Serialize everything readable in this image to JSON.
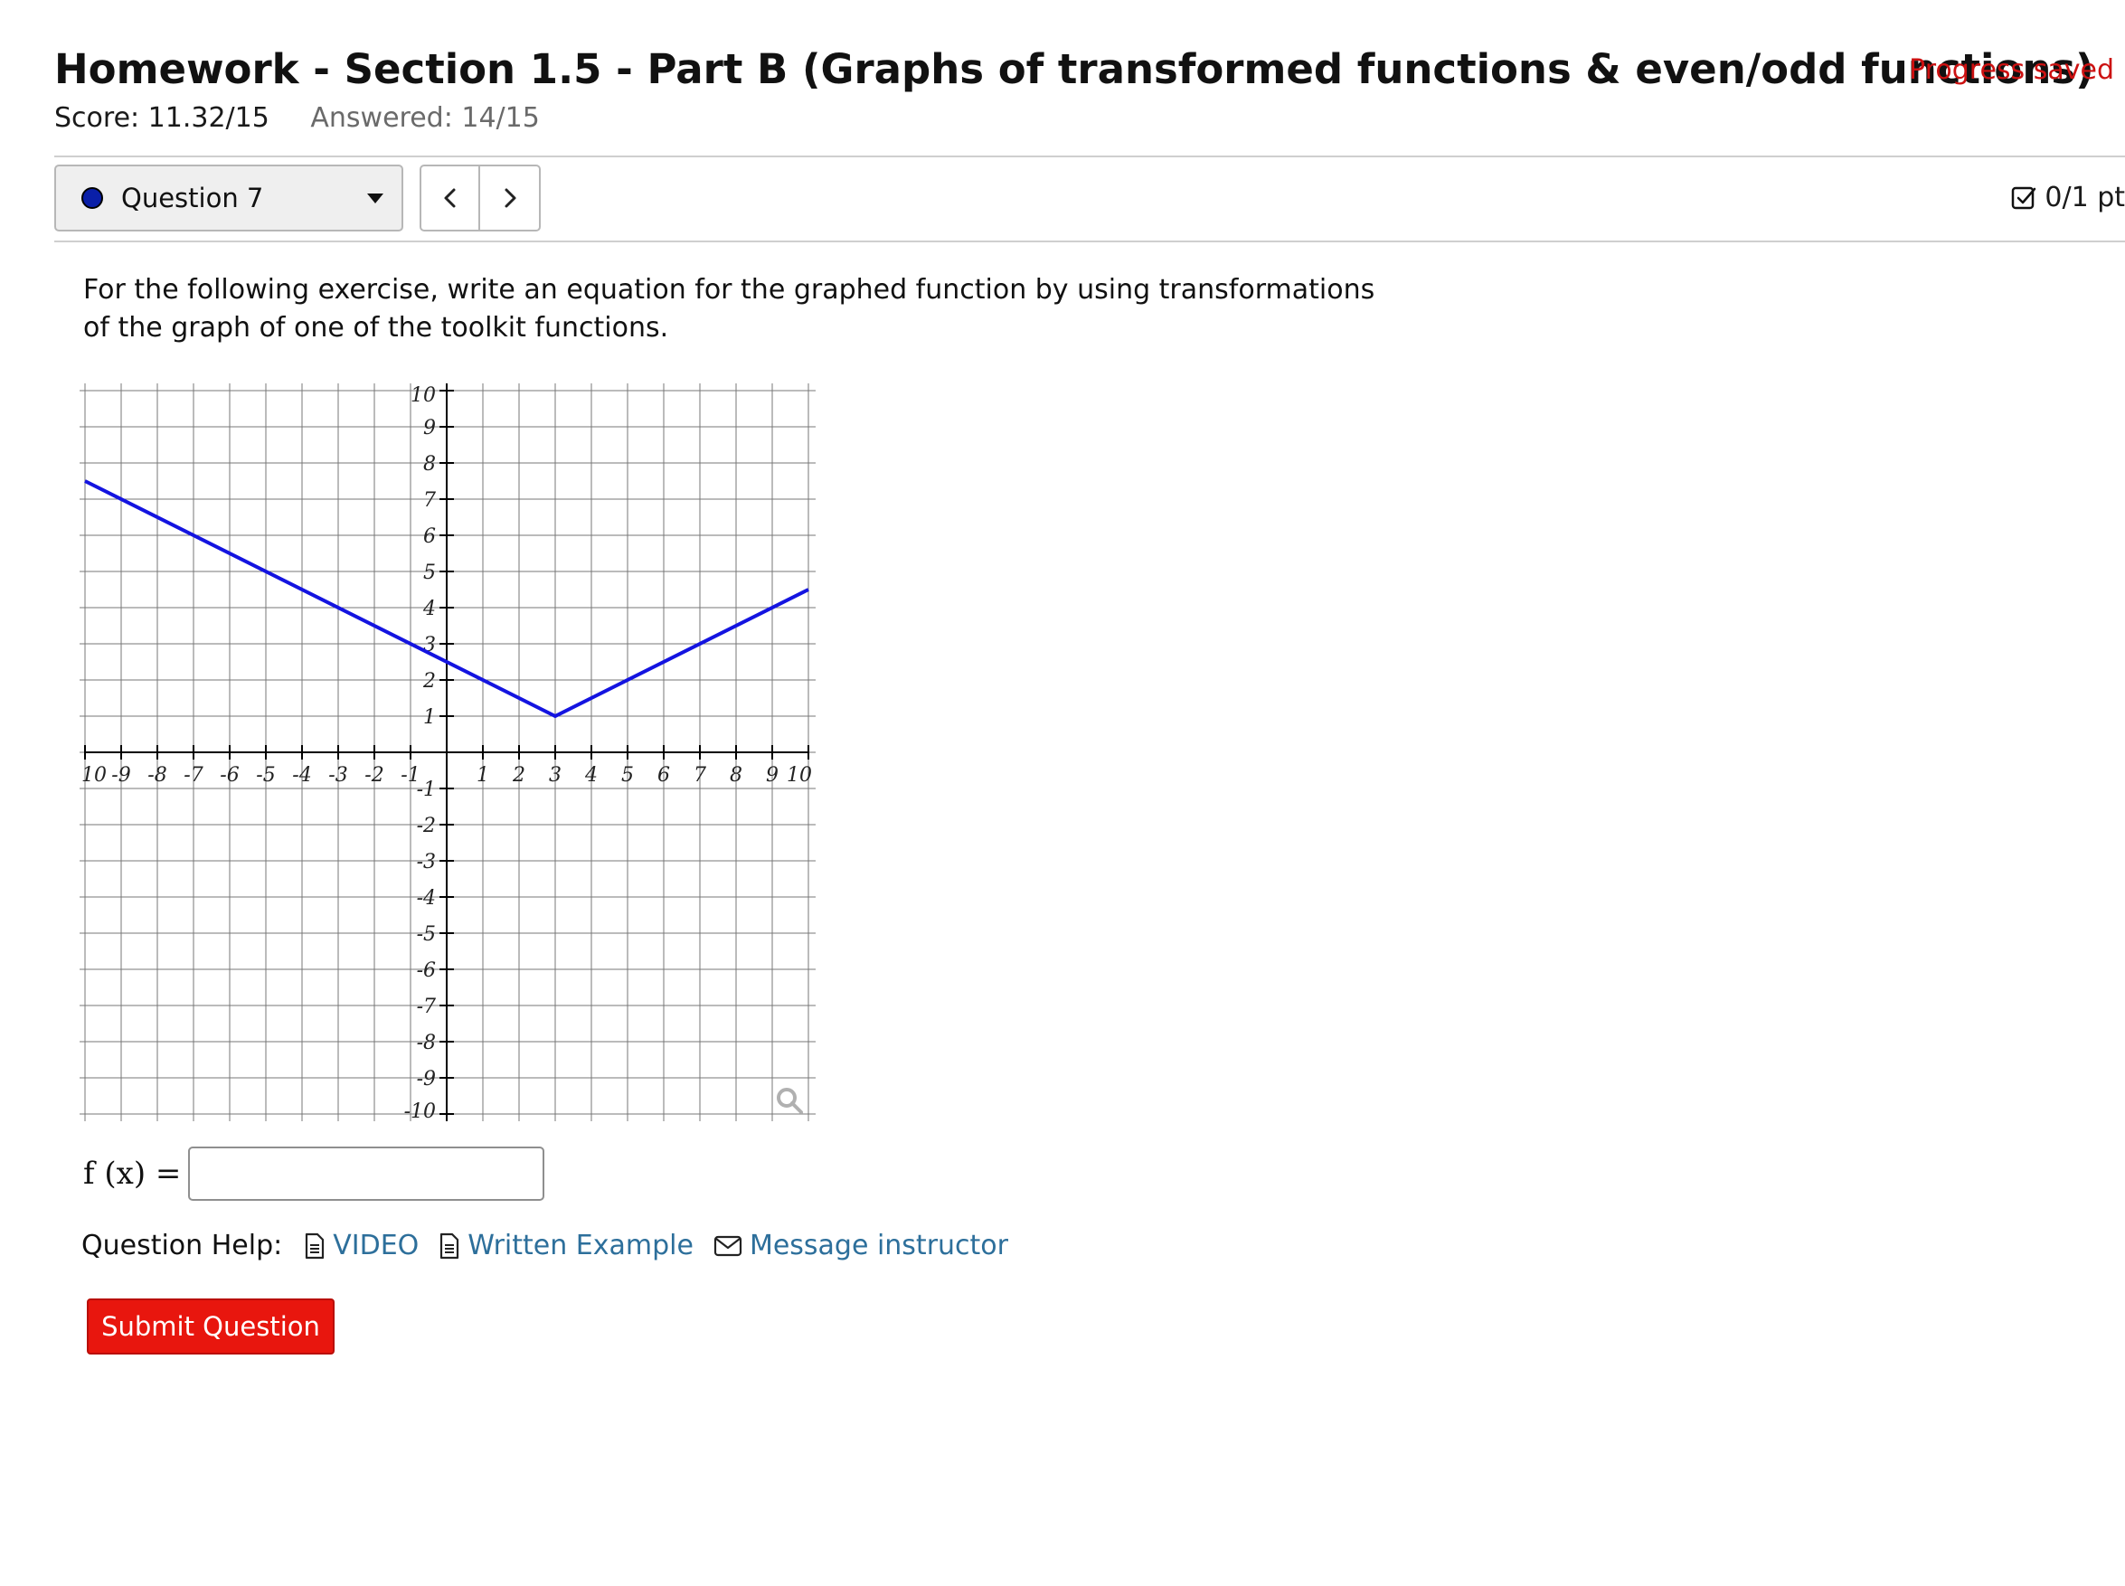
{
  "header": {
    "title": "Homework - Section 1.5 - Part B (Graphs of transformed functions & even/odd functions)",
    "progress_status": "Progress saved",
    "score": "Score: 11.32/15",
    "answered": "Answered: 14/15"
  },
  "question_nav": {
    "selected_question": "Question 7",
    "status_dot_color": "#0a1fa8",
    "prev_icon": "chevron-left-icon",
    "next_icon": "chevron-right-icon",
    "points": "0/1 pt",
    "points_icon": "checkbox-icon"
  },
  "question": {
    "prompt": "For the following exercise, write an equation for the graphed function by using transformations of the graph of one of the toolkit functions.",
    "answer_label": "f (x) =",
    "answer_value": ""
  },
  "chart_data": {
    "type": "line",
    "xlim": [
      -10,
      10
    ],
    "ylim": [
      -10,
      10
    ],
    "grid": true,
    "x_tick_labels": [
      "10",
      "-9",
      "-8",
      "-7",
      "-6",
      "-5",
      "-4",
      "-3",
      "-2",
      "-1",
      "1",
      "2",
      "3",
      "4",
      "5",
      "6",
      "7",
      "8",
      "9",
      "10"
    ],
    "x_tick_values": [
      -10,
      -9,
      -8,
      -7,
      -6,
      -5,
      -4,
      -3,
      -2,
      -1,
      1,
      2,
      3,
      4,
      5,
      6,
      7,
      8,
      9,
      10
    ],
    "y_tick_labels": [
      "10",
      "9",
      "8",
      "7",
      "6",
      "5",
      "4",
      "3",
      "2",
      "1",
      "-1",
      "-2",
      "-3",
      "-4",
      "-5",
      "-6",
      "-7",
      "-8",
      "-9",
      "-10"
    ],
    "y_tick_values": [
      10,
      9,
      8,
      7,
      6,
      5,
      4,
      3,
      2,
      1,
      -1,
      -2,
      -3,
      -4,
      -5,
      -6,
      -7,
      -8,
      -9,
      -10
    ],
    "series": [
      {
        "color": "#1414e0",
        "x": [
          -10,
          3,
          10
        ],
        "y": [
          7.5,
          1,
          4.5
        ]
      }
    ],
    "zoom_icon": "magnifier-icon"
  },
  "help": {
    "label": "Question Help:",
    "links": [
      {
        "label": "VIDEO",
        "icon": "document-icon"
      },
      {
        "label": "Written Example",
        "icon": "document-icon"
      },
      {
        "label": "Message instructor",
        "icon": "envelope-icon"
      }
    ],
    "link_color": "#2d6f9b"
  },
  "submit": {
    "label": "Submit Question",
    "color": "#e8160e"
  }
}
